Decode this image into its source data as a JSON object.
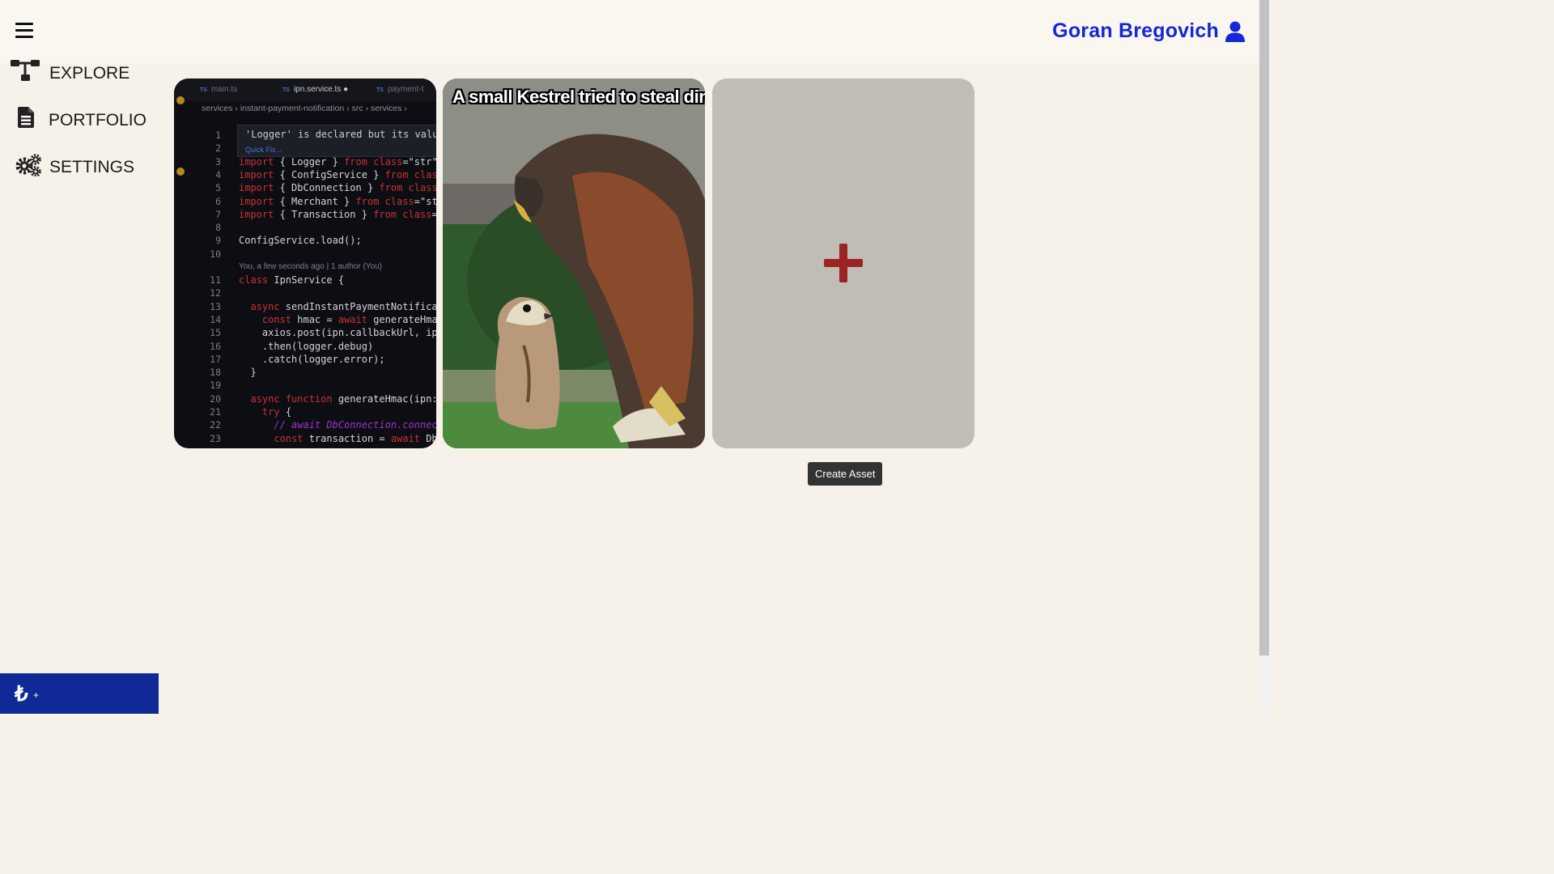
{
  "header": {
    "user_name": "Goran Bregovich",
    "accent_color": "#1428d6"
  },
  "sidebar": {
    "items": [
      {
        "label": "EXPLORE",
        "icon": "sitemap-icon"
      },
      {
        "label": "PORTFOLIO",
        "icon": "document-icon"
      },
      {
        "label": "SETTINGS",
        "icon": "gears-icon"
      }
    ]
  },
  "bottom_bar": {
    "glyph": "₺",
    "badge": "+",
    "color": "#0f2a96"
  },
  "assets": {
    "code_card": {
      "tabs": [
        "main.ts",
        "ipn.service.ts",
        "payment-t"
      ],
      "breadcrumb": "services  ›  instant-payment-notification  ›  src  ›  services  ›",
      "hover_header": "You, a few seconds ago | 1 author (You)",
      "warning": "'Logger' is declared but its value",
      "quick_fix": "Quick Fix...",
      "blame": "You, a few seconds ago | 1 author (You)",
      "lines": [
        {
          "n": "1",
          "t": ""
        },
        {
          "n": "2",
          "t": ""
        },
        {
          "n": "3",
          "t": "import { Logger } from '../../../c"
        },
        {
          "n": "4",
          "t": "import { ConfigService } from './c"
        },
        {
          "n": "5",
          "t": "import { DbConnection } from '../."
        },
        {
          "n": "6",
          "t": "import { Merchant } from '../../.."
        },
        {
          "n": "7",
          "t": "import { Transaction } from 'typeo"
        },
        {
          "n": "8",
          "t": ""
        },
        {
          "n": "9",
          "t": "ConfigService.load();"
        },
        {
          "n": "10",
          "t": ""
        },
        {
          "n": "11",
          "t": "class IpnService {"
        },
        {
          "n": "12",
          "t": ""
        },
        {
          "n": "13",
          "t": "  async sendInstantPaymentNotifica"
        },
        {
          "n": "14",
          "t": "    const hmac = await generateHma"
        },
        {
          "n": "15",
          "t": "    axios.post(ipn.callbackUrl, ip"
        },
        {
          "n": "16",
          "t": "    .then(logger.debug)"
        },
        {
          "n": "17",
          "t": "    .catch(logger.error);"
        },
        {
          "n": "18",
          "t": "  }"
        },
        {
          "n": "19",
          "t": ""
        },
        {
          "n": "20",
          "t": "  async function generateHmac(ipn:"
        },
        {
          "n": "21",
          "t": "    try {"
        },
        {
          "n": "22",
          "t": "      // await DbConnection.connec"
        },
        {
          "n": "23",
          "t": "      const transaction = await Db"
        }
      ]
    },
    "kestrel_card": {
      "caption": "A small Kestrel tried to steal din"
    },
    "create_card": {
      "tooltip": "Create Asset",
      "plus_color": "#9b2323"
    }
  }
}
